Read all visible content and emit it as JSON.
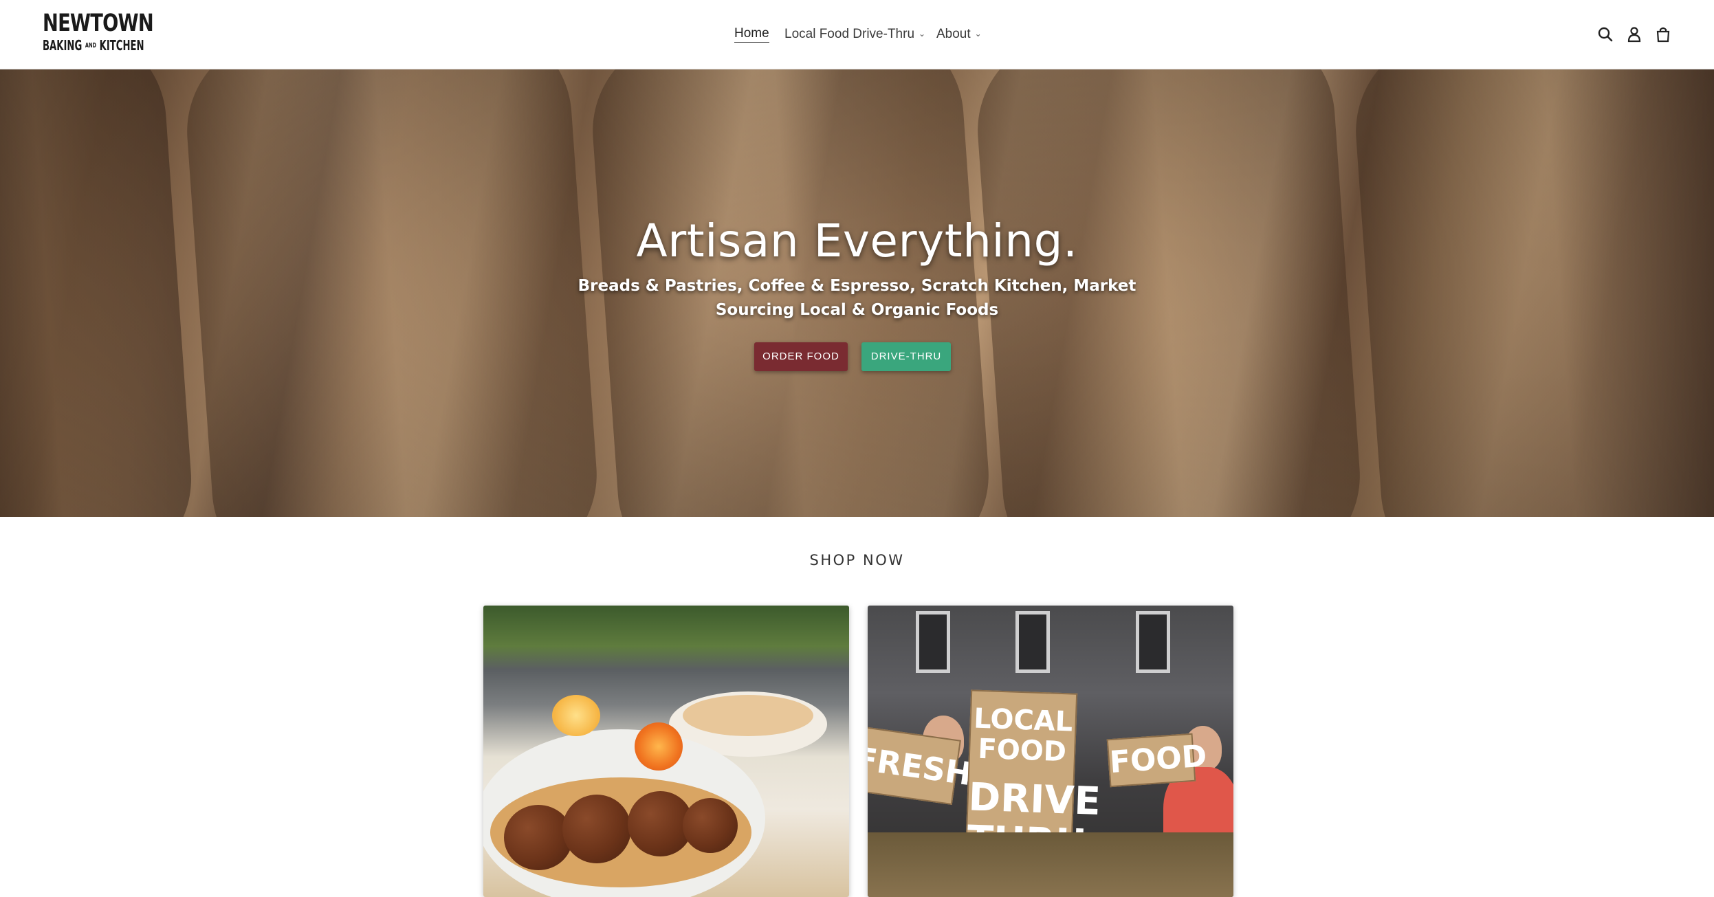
{
  "header": {
    "logo": {
      "line1": "NEWTOWN",
      "line2_a": "BAKING",
      "line2_b": "AND",
      "line2_c": "KITCHEN"
    },
    "nav": [
      {
        "label": "Home",
        "active": true
      },
      {
        "label": "Local Food Drive-Thru",
        "has_dropdown": true
      },
      {
        "label": "About",
        "has_dropdown": true
      }
    ],
    "icons": [
      "search-icon",
      "account-icon",
      "cart-icon"
    ]
  },
  "hero": {
    "title": "Artisan Everything.",
    "subtitle_line1": "Breads & Pastries, Coffee & Espresso, Scratch Kitchen, Market",
    "subtitle_line2": "Sourcing Local & Organic Foods",
    "buttons": {
      "order_label": "ORDER FOOD",
      "drive_label": "DRIVE-THRU"
    }
  },
  "shop": {
    "heading": "SHOP NOW",
    "cards": [
      {
        "image": "falafel-flatbread-photo"
      },
      {
        "image": "local-food-drive-thru-photo",
        "signs": [
          "FRESH",
          "LOCAL FOOD",
          "DRIVE THRU",
          "FOOD"
        ]
      }
    ]
  },
  "colors": {
    "order_button": "#7a2b31",
    "drive_button": "#3aa67d",
    "text": "#3a3a3a"
  }
}
